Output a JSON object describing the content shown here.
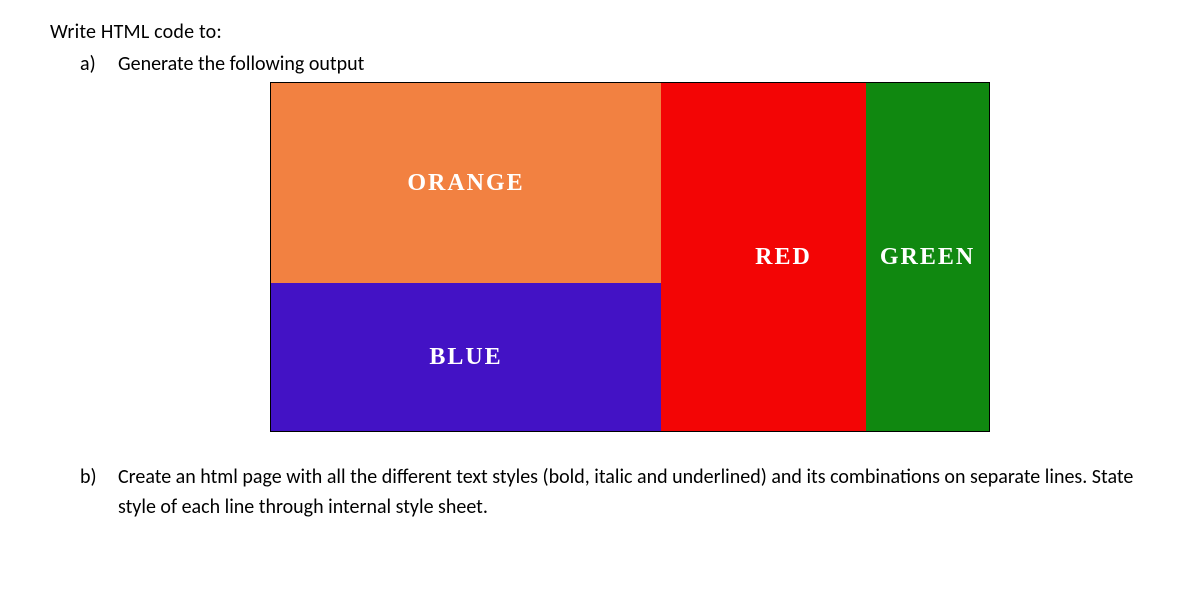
{
  "intro": "Write HTML code to:",
  "items": {
    "a": {
      "letter": "a)",
      "text": "Generate the following output"
    },
    "b": {
      "letter": "b)",
      "text": "Create an html page with all the different text styles (bold, italic and underlined) and its combinations on separate lines. State style of each line through internal style sheet."
    }
  },
  "colors": {
    "orange": {
      "label": "ORANGE",
      "hex": "#f28141"
    },
    "blue": {
      "label": "BLUE",
      "hex": "#4312c5"
    },
    "red": {
      "label": "RED",
      "hex": "#f30505"
    },
    "green": {
      "label": "GREEN",
      "hex": "#108810"
    }
  }
}
